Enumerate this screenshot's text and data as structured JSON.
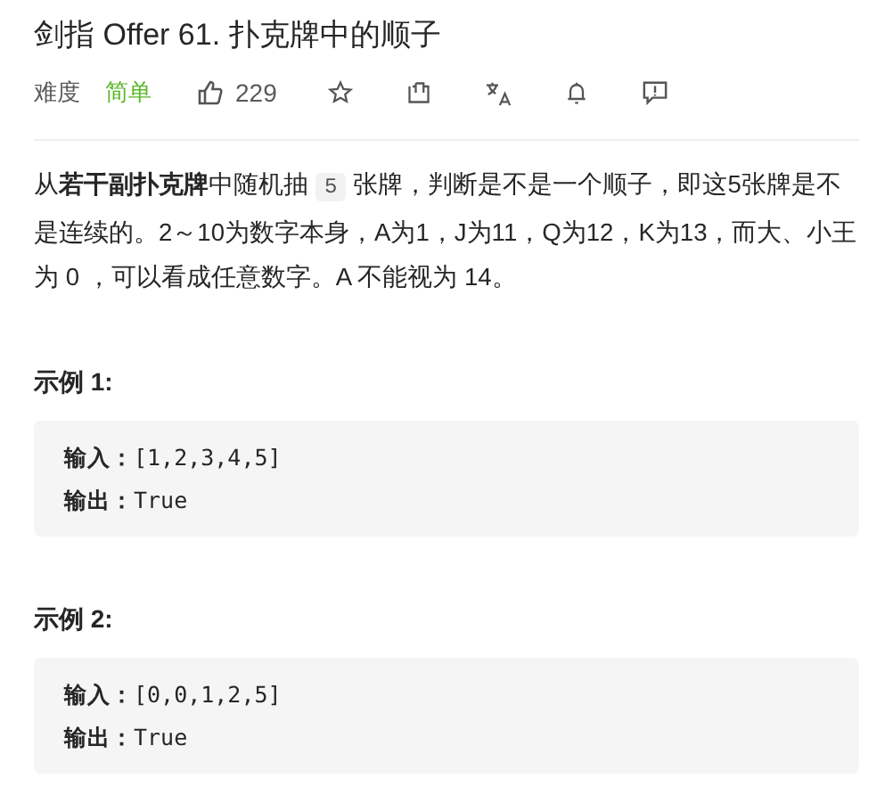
{
  "title": "剑指 Offer 61. 扑克牌中的顺子",
  "meta": {
    "difficulty_label": "难度",
    "difficulty": "简单",
    "likes": "229",
    "actions": [
      {
        "kind": "star"
      },
      {
        "kind": "share"
      },
      {
        "kind": "translate"
      },
      {
        "kind": "bell"
      },
      {
        "kind": "feedback"
      }
    ]
  },
  "description": [
    {
      "kind": "text",
      "text": "从**若干副扑克牌**中随机抽"
    },
    {
      "kind": "code",
      "text": "5"
    },
    {
      "kind": "text",
      "text": "张牌，判断是不是一个顺子，即这5张牌是不是连续的。2～10为数字本身，A为1，J为11，Q为12，K为13，而大、小王为 0 ，可以看成任意数字。A 不能视为 14。"
    }
  ],
  "examples": [
    {
      "heading": "示例 1:",
      "lines": [
        "**输入：**[1,2,3,4,5]",
        "**输出：**True"
      ]
    },
    {
      "heading": "示例 2:",
      "lines": [
        "**输入：**[0,0,1,2,5]",
        "**输出：**True"
      ]
    }
  ]
}
